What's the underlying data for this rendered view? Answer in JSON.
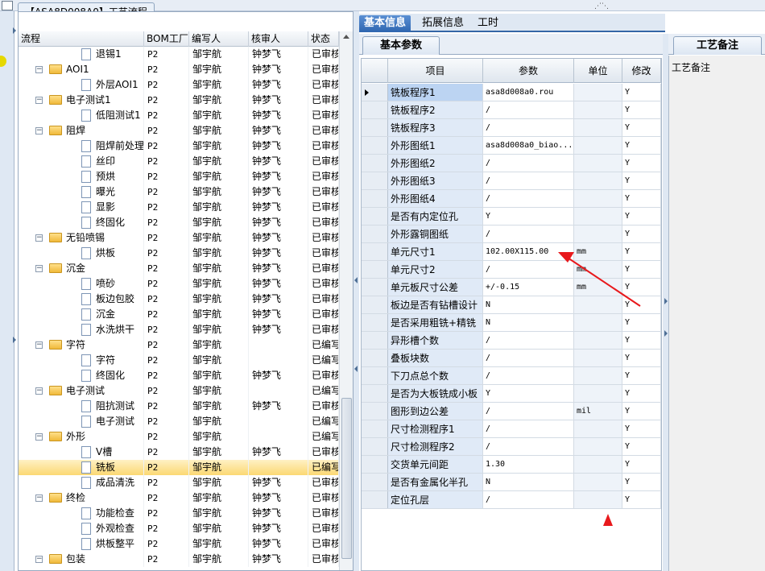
{
  "window": {
    "title": "【ASA8D008A0】工艺流程"
  },
  "tree": {
    "columns": [
      "流程",
      "BOM工厂",
      "编写人",
      "核审人",
      "状态"
    ],
    "rows": [
      {
        "name": "退锡1",
        "level": 2,
        "kind": "doc",
        "bom": "P2",
        "author": "邹宇航",
        "reviewer": "钟梦飞",
        "status": "已审核"
      },
      {
        "name": "AOI1",
        "level": 1,
        "kind": "folder",
        "bom": "P2",
        "author": "邹宇航",
        "reviewer": "钟梦飞",
        "status": "已审核"
      },
      {
        "name": "外层AOI1",
        "level": 2,
        "kind": "doc",
        "bom": "P2",
        "author": "邹宇航",
        "reviewer": "钟梦飞",
        "status": "已审核"
      },
      {
        "name": "电子测试1",
        "level": 1,
        "kind": "folder",
        "bom": "P2",
        "author": "邹宇航",
        "reviewer": "钟梦飞",
        "status": "已审核"
      },
      {
        "name": "低阻测试1",
        "level": 2,
        "kind": "doc",
        "bom": "P2",
        "author": "邹宇航",
        "reviewer": "钟梦飞",
        "status": "已审核"
      },
      {
        "name": "阻焊",
        "level": 1,
        "kind": "folder",
        "bom": "P2",
        "author": "邹宇航",
        "reviewer": "钟梦飞",
        "status": "已审核"
      },
      {
        "name": "阻焊前处理",
        "level": 2,
        "kind": "doc",
        "bom": "P2",
        "author": "邹宇航",
        "reviewer": "钟梦飞",
        "status": "已审核"
      },
      {
        "name": "丝印",
        "level": 2,
        "kind": "doc",
        "bom": "P2",
        "author": "邹宇航",
        "reviewer": "钟梦飞",
        "status": "已审核"
      },
      {
        "name": "预烘",
        "level": 2,
        "kind": "doc",
        "bom": "P2",
        "author": "邹宇航",
        "reviewer": "钟梦飞",
        "status": "已审核"
      },
      {
        "name": "曝光",
        "level": 2,
        "kind": "doc",
        "bom": "P2",
        "author": "邹宇航",
        "reviewer": "钟梦飞",
        "status": "已审核"
      },
      {
        "name": "显影",
        "level": 2,
        "kind": "doc",
        "bom": "P2",
        "author": "邹宇航",
        "reviewer": "钟梦飞",
        "status": "已审核"
      },
      {
        "name": "终固化",
        "level": 2,
        "kind": "doc",
        "bom": "P2",
        "author": "邹宇航",
        "reviewer": "钟梦飞",
        "status": "已审核"
      },
      {
        "name": "无铅喷锡",
        "level": 1,
        "kind": "folder",
        "bom": "P2",
        "author": "邹宇航",
        "reviewer": "钟梦飞",
        "status": "已审核"
      },
      {
        "name": "烘板",
        "level": 2,
        "kind": "doc",
        "bom": "P2",
        "author": "邹宇航",
        "reviewer": "钟梦飞",
        "status": "已审核"
      },
      {
        "name": "沉金",
        "level": 1,
        "kind": "folder",
        "bom": "P2",
        "author": "邹宇航",
        "reviewer": "钟梦飞",
        "status": "已审核"
      },
      {
        "name": "喷砂",
        "level": 2,
        "kind": "doc",
        "bom": "P2",
        "author": "邹宇航",
        "reviewer": "钟梦飞",
        "status": "已审核"
      },
      {
        "name": "板边包胶",
        "level": 2,
        "kind": "doc",
        "bom": "P2",
        "author": "邹宇航",
        "reviewer": "钟梦飞",
        "status": "已审核"
      },
      {
        "name": "沉金",
        "level": 2,
        "kind": "doc",
        "bom": "P2",
        "author": "邹宇航",
        "reviewer": "钟梦飞",
        "status": "已审核"
      },
      {
        "name": "水洗烘干",
        "level": 2,
        "kind": "doc",
        "bom": "P2",
        "author": "邹宇航",
        "reviewer": "钟梦飞",
        "status": "已审核"
      },
      {
        "name": "字符",
        "level": 1,
        "kind": "folder",
        "bom": "P2",
        "author": "邹宇航",
        "reviewer": "",
        "status": "已编写"
      },
      {
        "name": "字符",
        "level": 2,
        "kind": "doc",
        "bom": "P2",
        "author": "邹宇航",
        "reviewer": "",
        "status": "已编写"
      },
      {
        "name": "终固化",
        "level": 2,
        "kind": "doc",
        "bom": "P2",
        "author": "邹宇航",
        "reviewer": "钟梦飞",
        "status": "已审核"
      },
      {
        "name": "电子测试",
        "level": 1,
        "kind": "folder",
        "bom": "P2",
        "author": "邹宇航",
        "reviewer": "",
        "status": "已编写"
      },
      {
        "name": "阻抗测试",
        "level": 2,
        "kind": "doc",
        "bom": "P2",
        "author": "邹宇航",
        "reviewer": "钟梦飞",
        "status": "已审核"
      },
      {
        "name": "电子测试",
        "level": 2,
        "kind": "doc",
        "bom": "P2",
        "author": "邹宇航",
        "reviewer": "",
        "status": "已编写"
      },
      {
        "name": "外形",
        "level": 1,
        "kind": "folder",
        "bom": "P2",
        "author": "邹宇航",
        "reviewer": "",
        "status": "已编写"
      },
      {
        "name": "V槽",
        "level": 2,
        "kind": "doc",
        "bom": "P2",
        "author": "邹宇航",
        "reviewer": "钟梦飞",
        "status": "已审核"
      },
      {
        "name": "铣板",
        "level": 2,
        "kind": "doc",
        "bom": "P2",
        "author": "邹宇航",
        "reviewer": "",
        "status": "已编写",
        "selected": true
      },
      {
        "name": "成品清洗",
        "level": 2,
        "kind": "doc",
        "bom": "P2",
        "author": "邹宇航",
        "reviewer": "钟梦飞",
        "status": "已审核"
      },
      {
        "name": "终检",
        "level": 1,
        "kind": "folder",
        "bom": "P2",
        "author": "邹宇航",
        "reviewer": "钟梦飞",
        "status": "已审核"
      },
      {
        "name": "功能检查",
        "level": 2,
        "kind": "doc",
        "bom": "P2",
        "author": "邹宇航",
        "reviewer": "钟梦飞",
        "status": "已审核"
      },
      {
        "name": "外观检查",
        "level": 2,
        "kind": "doc",
        "bom": "P2",
        "author": "邹宇航",
        "reviewer": "钟梦飞",
        "status": "已审核"
      },
      {
        "name": "烘板整平",
        "level": 2,
        "kind": "doc",
        "bom": "P2",
        "author": "邹宇航",
        "reviewer": "钟梦飞",
        "status": "已审核"
      },
      {
        "name": "包装",
        "level": 1,
        "kind": "folder",
        "bom": "P2",
        "author": "邹宇航",
        "reviewer": "钟梦飞",
        "status": "已审核"
      }
    ]
  },
  "main_tabs": [
    "基本信息",
    "拓展信息",
    "工时"
  ],
  "sub_tab": "基本参数",
  "grid": {
    "columns": [
      "项目",
      "参数",
      "单位",
      "修改"
    ],
    "rows": [
      {
        "item": "铣板程序1",
        "param": "asa8d008a0.rou",
        "unit": "",
        "mod": "Y"
      },
      {
        "item": "铣板程序2",
        "param": "/",
        "unit": "",
        "mod": "Y"
      },
      {
        "item": "铣板程序3",
        "param": "/",
        "unit": "",
        "mod": "Y"
      },
      {
        "item": "外形图纸1",
        "param": "asa8d008a0_biao...",
        "unit": "",
        "mod": "Y"
      },
      {
        "item": "外形图纸2",
        "param": "/",
        "unit": "",
        "mod": "Y"
      },
      {
        "item": "外形图纸3",
        "param": "/",
        "unit": "",
        "mod": "Y"
      },
      {
        "item": "外形图纸4",
        "param": "/",
        "unit": "",
        "mod": "Y"
      },
      {
        "item": "是否有内定位孔",
        "param": "Y",
        "unit": "",
        "mod": "Y"
      },
      {
        "item": "外形露铜图纸",
        "param": "/",
        "unit": "",
        "mod": "Y"
      },
      {
        "item": "单元尺寸1",
        "param": "102.00X115.00",
        "unit": "mm",
        "mod": "Y"
      },
      {
        "item": "单元尺寸2",
        "param": "/",
        "unit": "mm",
        "mod": "Y"
      },
      {
        "item": "单元板尺寸公差",
        "param": "+/-0.15",
        "unit": "mm",
        "mod": "Y"
      },
      {
        "item": "板边是否有钻槽设计",
        "param": "N",
        "unit": "",
        "mod": "Y"
      },
      {
        "item": "是否采用粗铣+精铣",
        "param": "N",
        "unit": "",
        "mod": "Y"
      },
      {
        "item": "异形槽个数",
        "param": "/",
        "unit": "",
        "mod": "Y"
      },
      {
        "item": "叠板块数",
        "param": "/",
        "unit": "",
        "mod": "Y"
      },
      {
        "item": "下刀点总个数",
        "param": "/",
        "unit": "",
        "mod": "Y"
      },
      {
        "item": "是否为大板铣成小板",
        "param": "Y",
        "unit": "",
        "mod": "Y"
      },
      {
        "item": "图形到边公差",
        "param": "/",
        "unit": "mil",
        "mod": "Y"
      },
      {
        "item": "尺寸检测程序1",
        "param": "/",
        "unit": "",
        "mod": "Y"
      },
      {
        "item": "尺寸检测程序2",
        "param": "/",
        "unit": "",
        "mod": "Y"
      },
      {
        "item": "交货单元间距",
        "param": "1.30",
        "unit": "",
        "mod": "Y"
      },
      {
        "item": "是否有金属化半孔",
        "param": "N",
        "unit": "",
        "mod": "Y"
      },
      {
        "item": "定位孔层",
        "param": "/",
        "unit": "",
        "mod": "Y"
      }
    ]
  },
  "notes": {
    "tab": "工艺备注",
    "label": "工艺备注"
  },
  "colors": {
    "accent": "#2f66b0",
    "selection": "#fbd873",
    "annotation": "#e8191c",
    "folder": "#f0b93a"
  },
  "icons": [
    "folder-icon",
    "document-icon",
    "expander-icon",
    "row-pointer-icon",
    "sort-arrow-icon"
  ]
}
